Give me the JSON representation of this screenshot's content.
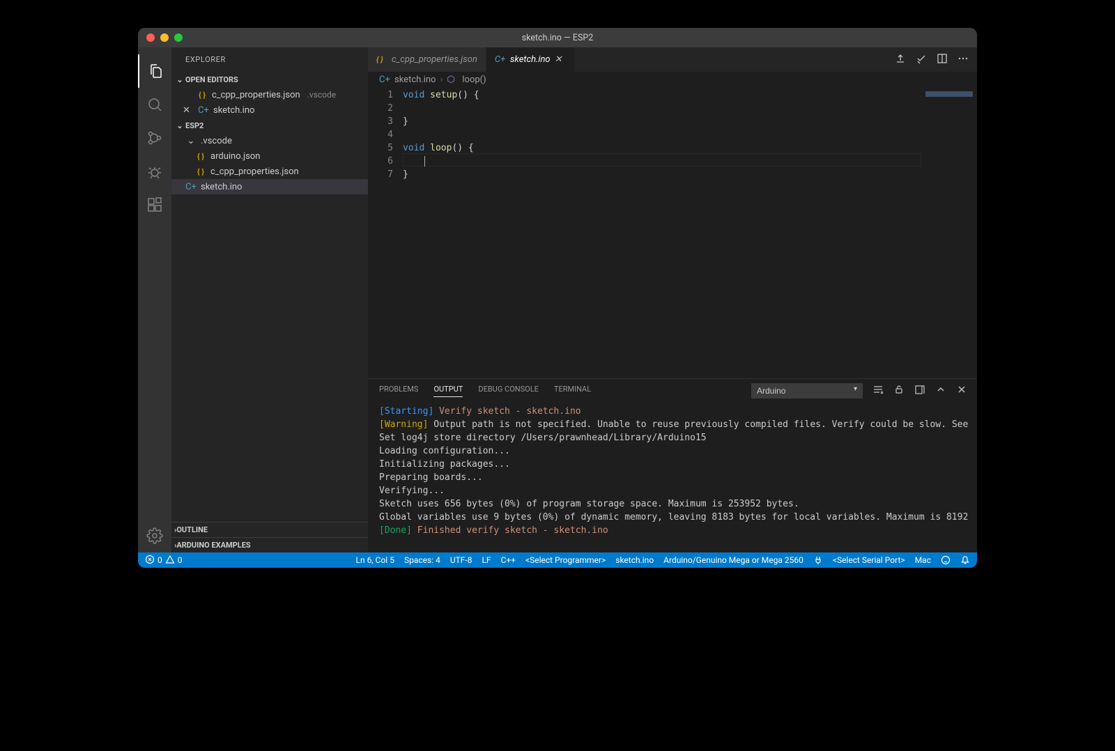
{
  "window": {
    "title": "sketch.ino — ESP2"
  },
  "sidebar": {
    "title": "EXPLORER",
    "open_editors_label": "OPEN EDITORS",
    "open_editors": [
      {
        "name": "c_cpp_properties.json",
        "folder": ".vscode",
        "icon": "json"
      },
      {
        "name": "sketch.ino",
        "folder": "",
        "icon": "cpp"
      }
    ],
    "project_label": "ESP2",
    "tree": {
      "vscode_folder": ".vscode",
      "files": [
        {
          "name": "arduino.json",
          "icon": "json"
        },
        {
          "name": "c_cpp_properties.json",
          "icon": "json"
        },
        {
          "name": "sketch.ino",
          "icon": "cpp",
          "selected": true
        }
      ]
    },
    "outline_label": "OUTLINE",
    "ardex_label": "ARDUINO EXAMPLES"
  },
  "tabs": [
    {
      "name": "c_cpp_properties.json",
      "icon": "json",
      "active": false
    },
    {
      "name": "sketch.ino",
      "icon": "cpp",
      "active": true
    }
  ],
  "breadcrumb": {
    "file": "sketch.ino",
    "symbol": "loop()"
  },
  "editor": {
    "lines": [
      {
        "n": "1",
        "tokens": [
          {
            "t": "void ",
            "c": "kw"
          },
          {
            "t": "setup",
            "c": "fn"
          },
          {
            "t": "() {",
            "c": "br"
          }
        ]
      },
      {
        "n": "2",
        "tokens": []
      },
      {
        "n": "3",
        "tokens": [
          {
            "t": "}",
            "c": "br"
          }
        ]
      },
      {
        "n": "4",
        "tokens": []
      },
      {
        "n": "5",
        "tokens": [
          {
            "t": "void ",
            "c": "kw"
          },
          {
            "t": "loop",
            "c": "fn"
          },
          {
            "t": "() {",
            "c": "br"
          }
        ]
      },
      {
        "n": "6",
        "tokens": [
          {
            "t": "    ",
            "c": ""
          }
        ],
        "cursor": true
      },
      {
        "n": "7",
        "tokens": [
          {
            "t": "}",
            "c": "br"
          }
        ]
      }
    ]
  },
  "panel": {
    "tabs": {
      "problems": "PROBLEMS",
      "output": "OUTPUT",
      "debug": "DEBUG CONSOLE",
      "terminal": "TERMINAL"
    },
    "channel": "Arduino",
    "output": [
      {
        "spans": [
          {
            "t": "[Starting]",
            "c": "c-blue"
          },
          {
            "t": " ",
            "c": ""
          },
          {
            "t": "Verify sketch - sketch.ino",
            "c": "c-orange"
          }
        ]
      },
      {
        "spans": [
          {
            "t": "[Warning]",
            "c": "c-yellow"
          },
          {
            "t": " Output path is not specified. Unable to reuse previously compiled files. Verify could be slow. See",
            "c": ""
          }
        ]
      },
      {
        "spans": [
          {
            "t": "Set log4j store directory /Users/prawnhead/Library/Arduino15",
            "c": ""
          }
        ]
      },
      {
        "spans": [
          {
            "t": "Loading configuration...",
            "c": ""
          }
        ]
      },
      {
        "spans": [
          {
            "t": "Initializing packages...",
            "c": ""
          }
        ]
      },
      {
        "spans": [
          {
            "t": "Preparing boards...",
            "c": ""
          }
        ]
      },
      {
        "spans": [
          {
            "t": "Verifying...",
            "c": ""
          }
        ]
      },
      {
        "spans": [
          {
            "t": "Sketch uses 656 bytes (0%) of program storage space. Maximum is 253952 bytes.",
            "c": ""
          }
        ]
      },
      {
        "spans": [
          {
            "t": "Global variables use 9 bytes (0%) of dynamic memory, leaving 8183 bytes for local variables. Maximum is 8192",
            "c": ""
          }
        ]
      },
      {
        "spans": [
          {
            "t": "[Done]",
            "c": "c-green"
          },
          {
            "t": " ",
            "c": ""
          },
          {
            "t": "Finished verify sketch - sketch.ino",
            "c": "c-orange"
          }
        ]
      }
    ]
  },
  "status": {
    "errors": "0",
    "warnings": "0",
    "lncol": "Ln 6, Col 5",
    "spaces": "Spaces: 4",
    "encoding": "UTF-8",
    "eol": "LF",
    "lang": "C++",
    "programmer": "<Select Programmer>",
    "sketch": "sketch.ino",
    "board": "Arduino/Genuino Mega or Mega 2560",
    "serial": "<Select Serial Port>",
    "host": "Mac"
  }
}
